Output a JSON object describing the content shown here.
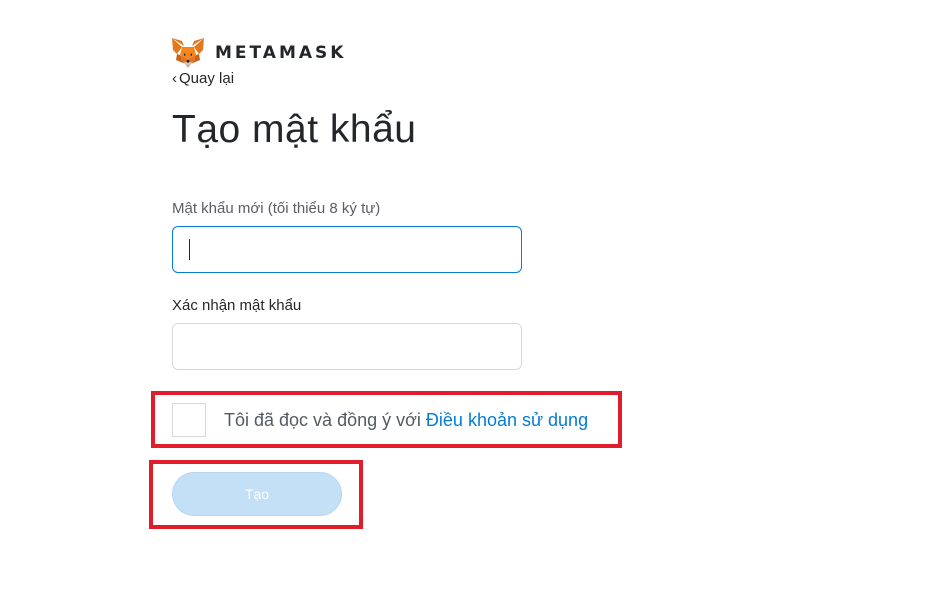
{
  "brand": {
    "name": "METAMASK",
    "logo_icon": "metamask-fox-icon"
  },
  "nav": {
    "back_label": "Quay lại",
    "back_icon": "chevron-left-icon"
  },
  "page": {
    "title": "Tạo mật khẩu"
  },
  "form": {
    "new_password": {
      "label": "Mật khẩu mới (tối thiểu 8 ký tự)",
      "value": ""
    },
    "confirm_password": {
      "label": "Xác nhận mật khẩu",
      "value": ""
    },
    "terms": {
      "checked": false,
      "text": "Tôi đã đọc và đồng ý với ",
      "link_label": "Điều khoản sử dụng"
    },
    "submit_label": "Tạo"
  },
  "colors": {
    "accent": "#037dd6",
    "button_disabled": "#c3e0f6",
    "highlight": "#e11c2b",
    "text": "#24272a"
  }
}
